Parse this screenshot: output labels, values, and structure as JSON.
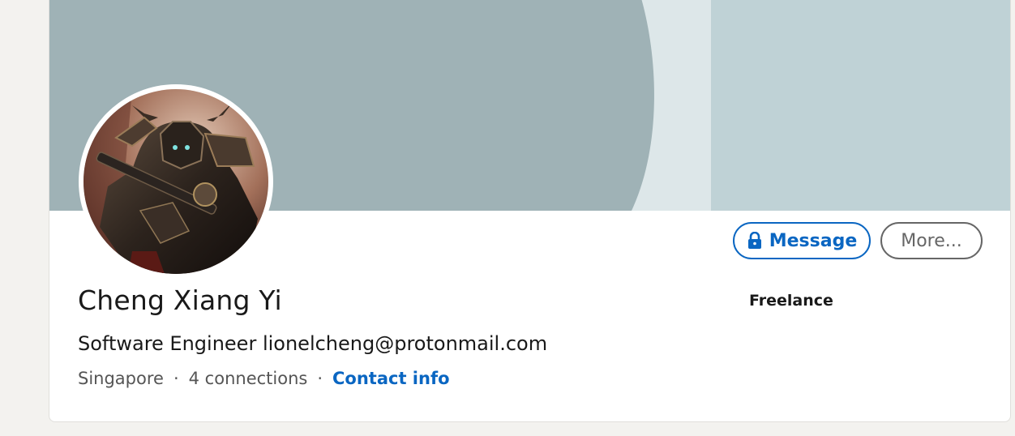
{
  "profile": {
    "name": "Cheng Xiang Yi",
    "headline": "Software Engineer lionelcheng@protonmail.com",
    "location": "Singapore",
    "connections": "4 connections",
    "separator": "·",
    "contact_info_label": "Contact info",
    "current_company": "Freelance"
  },
  "actions": {
    "message_label": "Message",
    "more_label": "More..."
  },
  "icons": {
    "message": "lock-icon"
  },
  "colors": {
    "accent": "#0a66c2",
    "banner_dark": "#9fb2b6",
    "banner_light": "#bfd2d6",
    "banner_mid": "#dde7e9",
    "page_bg": "#f3f2ef"
  }
}
